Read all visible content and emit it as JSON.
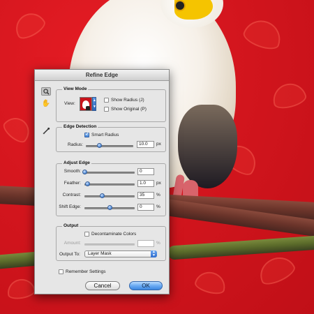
{
  "dialog": {
    "title": "Refine Edge",
    "tools": {
      "zoom": "zoom-tool-icon",
      "hand": "hand-tool-icon",
      "brush": "refine-radius-tool-icon"
    },
    "view_mode": {
      "title": "View Mode",
      "view_label": "View:",
      "show_radius_label": "Show Radius (J)",
      "show_radius_checked": false,
      "show_original_label": "Show Original (P)",
      "show_original_checked": false
    },
    "edge_detection": {
      "title": "Edge Detection",
      "smart_radius_label": "Smart Radius",
      "smart_radius_checked": true,
      "radius_label": "Radius:",
      "radius_value": "10.0",
      "radius_unit": "px",
      "radius_fraction": 0.28
    },
    "adjust_edge": {
      "title": "Adjust Edge",
      "smooth_label": "Smooth:",
      "smooth_value": "0",
      "smooth_fraction": 0.0,
      "feather_label": "Feather:",
      "feather_value": "1.0",
      "feather_unit": "px",
      "feather_fraction": 0.05,
      "contrast_label": "Contrast:",
      "contrast_value": "35",
      "contrast_unit": "%",
      "contrast_fraction": 0.35,
      "shift_edge_label": "Shift Edge:",
      "shift_edge_value": "0",
      "shift_edge_unit": "%",
      "shift_edge_fraction": 0.5
    },
    "output": {
      "title": "Output",
      "decontaminate_label": "Decontaminate Colors",
      "decontaminate_checked": false,
      "amount_label": "Amount:",
      "amount_value": "",
      "amount_unit": "%",
      "output_to_label": "Output To:",
      "output_to_value": "Layer Mask"
    },
    "remember_settings_label": "Remember Settings",
    "remember_settings_checked": false,
    "cancel_label": "Cancel",
    "ok_label": "OK"
  }
}
